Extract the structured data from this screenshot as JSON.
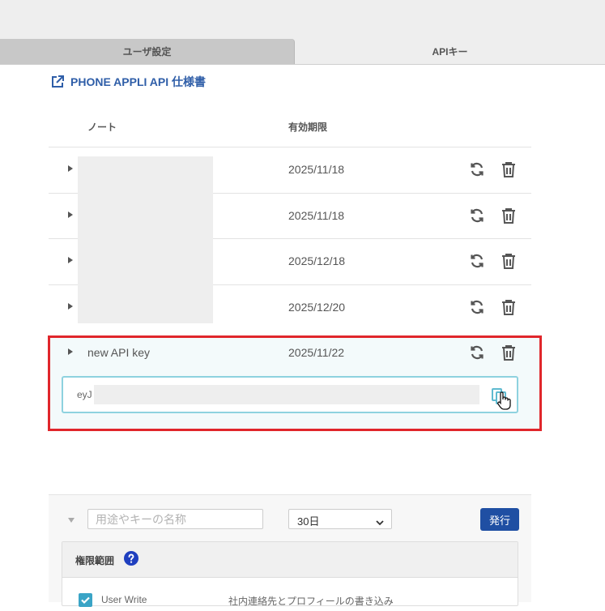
{
  "tabs": [
    {
      "label": "ユーザ設定",
      "active": false
    },
    {
      "label": "APIキー",
      "active": true
    }
  ],
  "doc_link": {
    "label": "PHONE APPLI API 仕様書",
    "icon": "external-link-icon"
  },
  "table": {
    "headers": {
      "note": "ノート",
      "expiry": "有効期限"
    },
    "rows": [
      {
        "note": "",
        "expiry": "2025/11/18"
      },
      {
        "note": "",
        "expiry": "2025/11/18"
      },
      {
        "note": "",
        "expiry": "2025/12/18"
      },
      {
        "note": "",
        "expiry": "2025/12/20"
      },
      {
        "note": "new API key",
        "expiry": "2025/11/22",
        "expanded": true
      }
    ],
    "row_actions": [
      "refresh-icon",
      "trash-icon"
    ]
  },
  "expanded_key": {
    "prefix": "eyJ",
    "copy_icon": "copy-icon"
  },
  "issue_form": {
    "name_placeholder": "用途やキーの名称",
    "period_value": "30日",
    "issue_button": "発行",
    "scope": {
      "title": "権限範囲",
      "items": [
        {
          "name": "User Write",
          "description": "社内連絡先とプロフィールの書き込み",
          "checked": true
        }
      ]
    }
  },
  "colors": {
    "accent_blue": "#1f4fa3",
    "link_blue": "#2f5ea8",
    "highlight_red": "#e0262b",
    "key_border": "#8ed2df",
    "checkbox": "#3aa4c6"
  }
}
